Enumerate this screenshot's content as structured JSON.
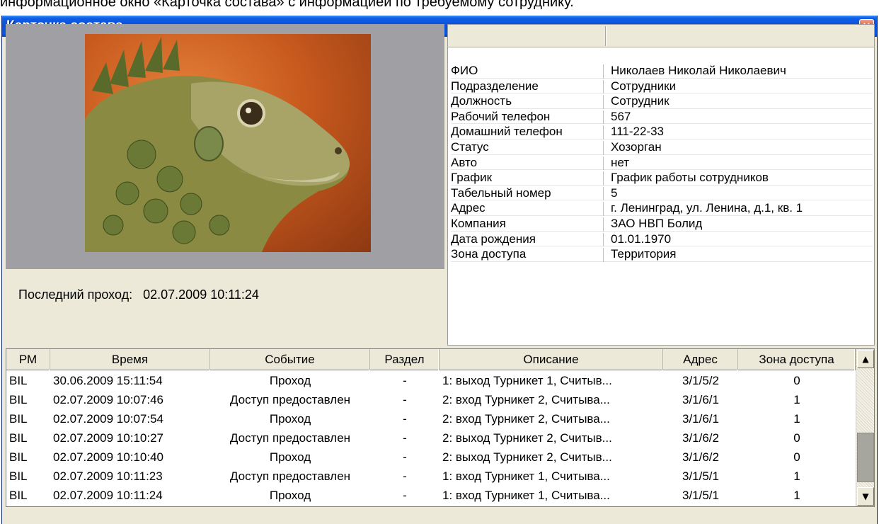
{
  "caption": "информационное окно «Карточка состава» с информацией по требуемому сотруднику.",
  "window": {
    "title": "Карточка состава",
    "close_glyph": "✕"
  },
  "photo": {
    "description_icon": "iguana-photo"
  },
  "last_pass": {
    "label": "Последний проход:",
    "value": "02.07.2009 10:11:24"
  },
  "info": {
    "rows": [
      {
        "key": "ФИО",
        "value": "Николаев Николай Николаевич"
      },
      {
        "key": "Подразделение",
        "value": "Сотрудники"
      },
      {
        "key": "Должность",
        "value": "Сотрудник"
      },
      {
        "key": "Рабочий телефон",
        "value": "567"
      },
      {
        "key": "Домашний телефон",
        "value": "111-22-33"
      },
      {
        "key": "Статус",
        "value": "Хозорган"
      },
      {
        "key": "Авто",
        "value": "нет"
      },
      {
        "key": "График",
        "value": "График работы сотрудников"
      },
      {
        "key": "Табельный номер",
        "value": "5"
      },
      {
        "key": "Адрес",
        "value": "г. Ленинград, ул. Ленина, д.1, кв. 1"
      },
      {
        "key": "Компания",
        "value": "ЗАО НВП Болид"
      },
      {
        "key": "Дата рождения",
        "value": "01.01.1970"
      },
      {
        "key": "Зона доступа",
        "value": "Территория"
      }
    ]
  },
  "events": {
    "columns": [
      "РМ",
      "Время",
      "Событие",
      "Раздел",
      "Описание",
      "Адрес",
      "Зона доступа"
    ],
    "rows": [
      [
        "BIL",
        "30.06.2009 15:11:54",
        "Проход",
        "-",
        "1: выход Турникет 1, Считыв...",
        "3/1/5/2",
        "0"
      ],
      [
        "BIL",
        "02.07.2009 10:07:46",
        "Доступ предоставлен",
        "-",
        "2: вход Турникет 2, Считыва...",
        "3/1/6/1",
        "1"
      ],
      [
        "BIL",
        "02.07.2009 10:07:54",
        "Проход",
        "-",
        "2: вход Турникет 2, Считыва...",
        "3/1/6/1",
        "1"
      ],
      [
        "BIL",
        "02.07.2009 10:10:27",
        "Доступ предоставлен",
        "-",
        "2: выход Турникет 2, Считыв...",
        "3/1/6/2",
        "0"
      ],
      [
        "BIL",
        "02.07.2009 10:10:40",
        "Проход",
        "-",
        "2: выход Турникет 2, Считыв...",
        "3/1/6/2",
        "0"
      ],
      [
        "BIL",
        "02.07.2009 10:11:23",
        "Доступ предоставлен",
        "-",
        "1: вход Турникет 1, Считыва...",
        "3/1/5/1",
        "1"
      ],
      [
        "BIL",
        "02.07.2009 10:11:24",
        "Проход",
        "-",
        "1: вход Турникет 1, Считыва...",
        "3/1/5/1",
        "1"
      ]
    ]
  },
  "scrollbar": {
    "up_glyph": "▲",
    "down_glyph": "▼"
  }
}
